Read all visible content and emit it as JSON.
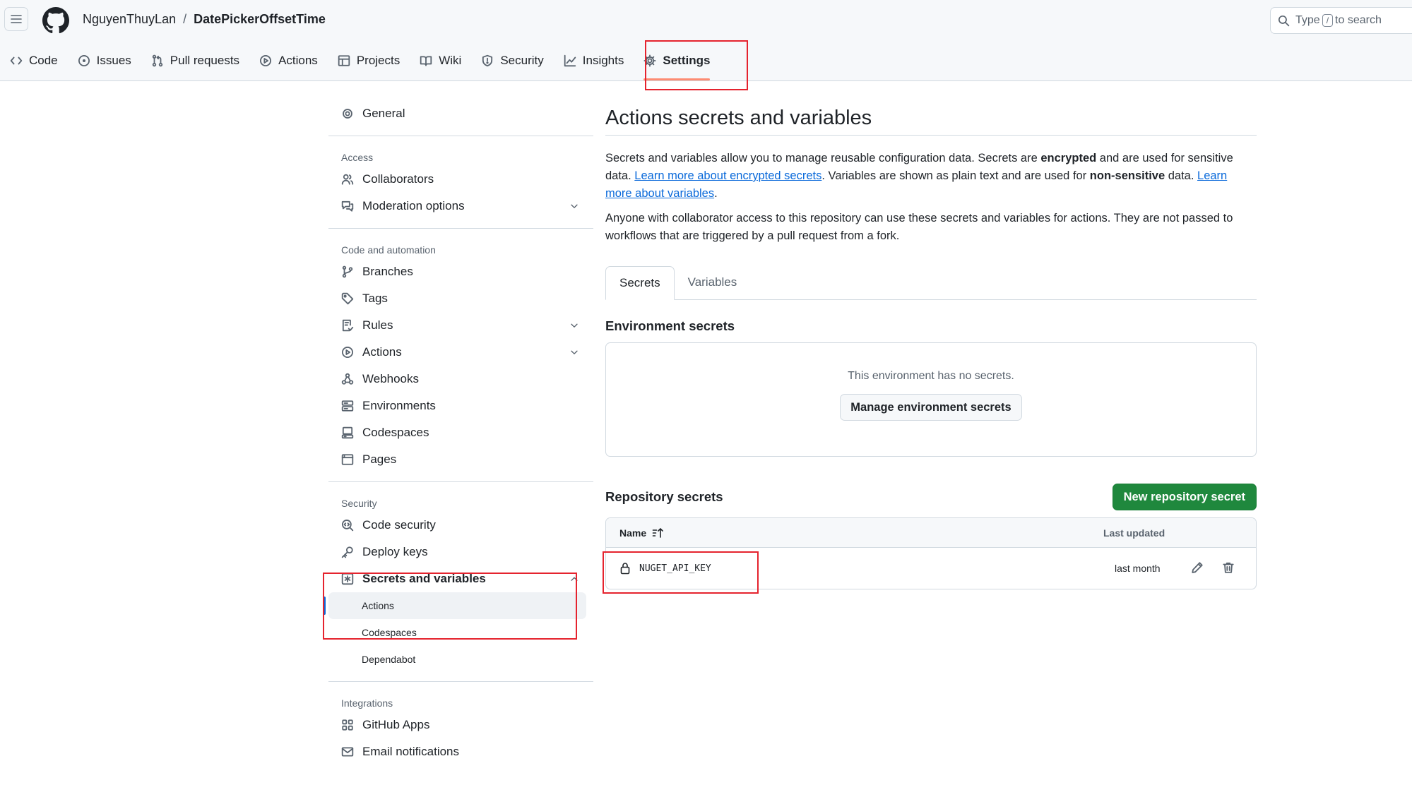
{
  "header": {
    "owner": "NguyenThuyLan",
    "separator": "/",
    "repo": "DatePickerOffsetTime",
    "search": {
      "prefix": "Type",
      "key": "/",
      "suffix": "to search"
    }
  },
  "repo_nav": [
    {
      "label": "Code",
      "icon": "code-icon"
    },
    {
      "label": "Issues",
      "icon": "issue-icon"
    },
    {
      "label": "Pull requests",
      "icon": "pull-request-icon"
    },
    {
      "label": "Actions",
      "icon": "play-icon"
    },
    {
      "label": "Projects",
      "icon": "table-icon"
    },
    {
      "label": "Wiki",
      "icon": "book-icon"
    },
    {
      "label": "Security",
      "icon": "shield-icon"
    },
    {
      "label": "Insights",
      "icon": "graph-icon"
    },
    {
      "label": "Settings",
      "icon": "gear-icon",
      "selected": true
    }
  ],
  "sidebar": {
    "general": "General",
    "access_heading": "Access",
    "access": [
      "Collaborators",
      "Moderation options"
    ],
    "code_heading": "Code and automation",
    "code": [
      "Branches",
      "Tags",
      "Rules",
      "Actions",
      "Webhooks",
      "Environments",
      "Codespaces",
      "Pages"
    ],
    "security_heading": "Security",
    "security": [
      "Code security",
      "Deploy keys",
      "Secrets and variables"
    ],
    "secrets_sub": [
      "Actions",
      "Codespaces",
      "Dependabot"
    ],
    "integrations_heading": "Integrations",
    "integrations": [
      "GitHub Apps",
      "Email notifications"
    ]
  },
  "main": {
    "title": "Actions secrets and variables",
    "desc": {
      "p1a": "Secrets and variables allow you to manage reusable configuration data. Secrets are ",
      "p1b": "encrypted",
      "p1c": " and are used for sensitive data. ",
      "link1": "Learn more about encrypted secrets",
      "p1d": ". Variables are shown as plain text and are used for ",
      "p1e": "non-sensitive",
      "p1f": " data. ",
      "link2": "Learn more about variables",
      "p1g": ".",
      "p2": "Anyone with collaborator access to this repository can use these secrets and variables for actions. They are not passed to workflows that are triggered by a pull request from a fork."
    },
    "tabs": [
      "Secrets",
      "Variables"
    ],
    "env_title": "Environment secrets",
    "env_empty": "This environment has no secrets.",
    "manage_button": "Manage environment secrets",
    "repo_title": "Repository secrets",
    "new_button": "New repository secret",
    "table": {
      "col_name": "Name",
      "col_updated": "Last updated",
      "rows": [
        {
          "name": "NUGET_API_KEY",
          "updated": "last month"
        }
      ]
    }
  },
  "colors": {
    "accent": "#0969da",
    "primary_button": "#1f883d",
    "selected_underline": "#fd8c73",
    "annotation": "#e5232e"
  }
}
